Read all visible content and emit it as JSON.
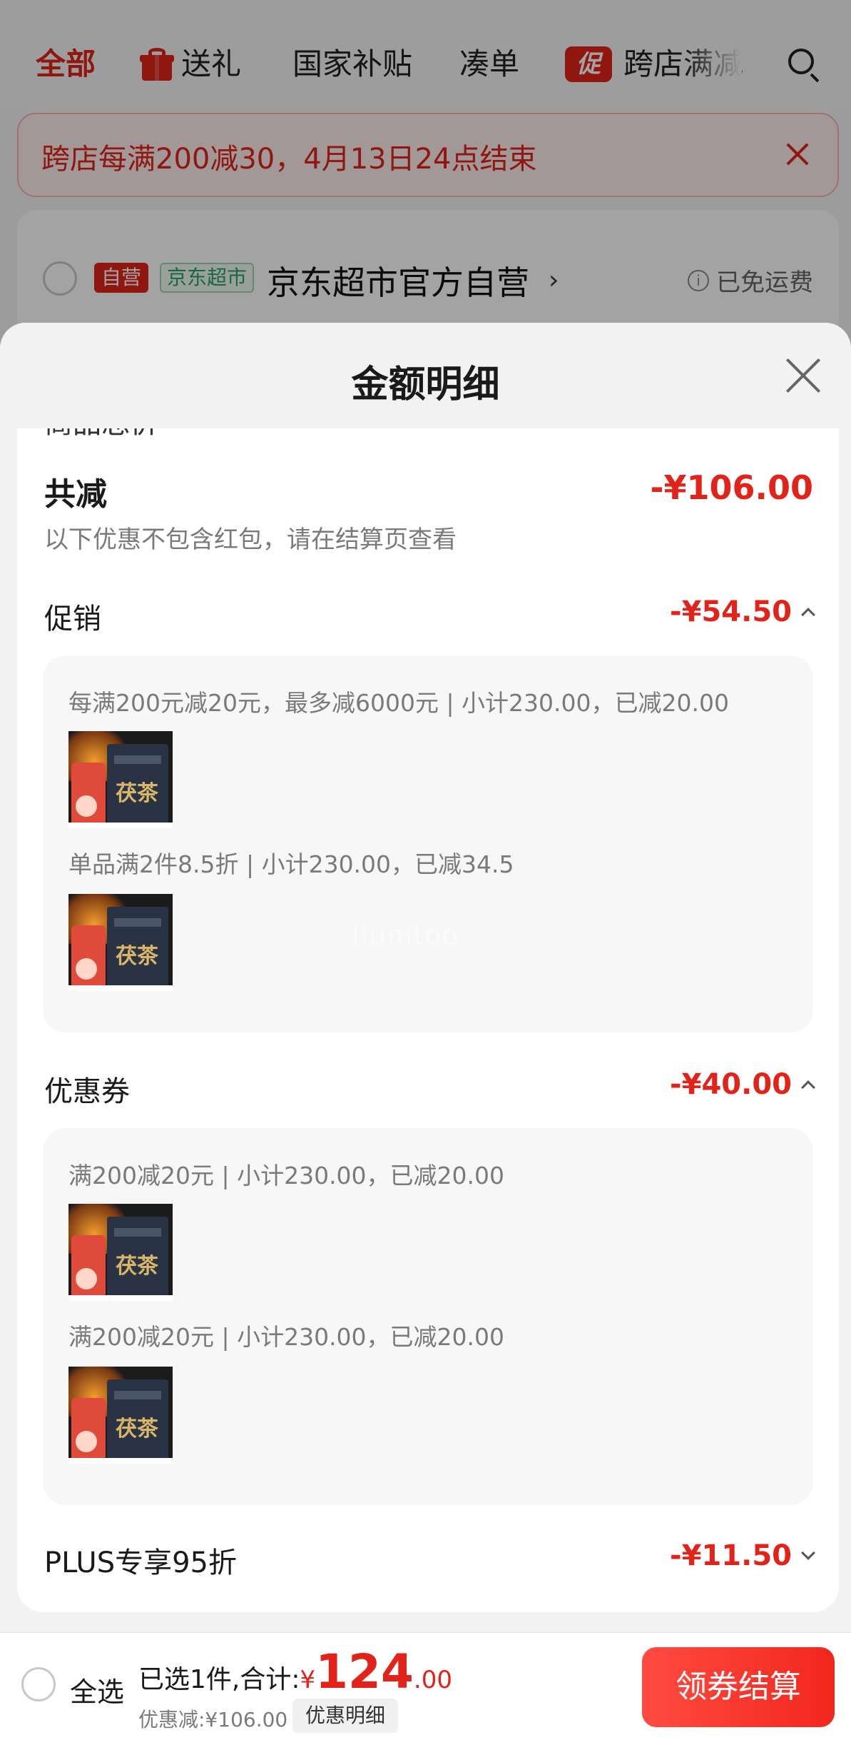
{
  "top_nav": {
    "tabs": [
      {
        "label": "全部"
      },
      {
        "label": "送礼",
        "icon": "gift-icon"
      },
      {
        "label": "国家补贴"
      },
      {
        "label": "凑单"
      },
      {
        "label": "跨店满减",
        "badge": "促"
      }
    ]
  },
  "promo_banner": {
    "text": "跨店每满200减30，4月13日24点结束"
  },
  "store": {
    "tag_self": "自营",
    "tag_market": "京东超市",
    "name": "京东超市官方自营",
    "chevron": "›",
    "shipping_icon": "i",
    "shipping": "已免运费"
  },
  "sheet": {
    "title": "金额明细",
    "cut_text": "商品总价",
    "total": {
      "label": "共减",
      "value": "-¥106.00",
      "note": "以下优惠不包含红包，请在结算页查看"
    },
    "promotion": {
      "label": "促销",
      "value": "-¥54.50",
      "items": [
        {
          "text": "每满200元减20元，最多减6000元 | 小计230.00，已减20.00",
          "product_text": "茯茶"
        },
        {
          "text": "单品满2件8.5折 | 小计230.00，已减34.5",
          "product_text": "茯茶"
        }
      ]
    },
    "coupon": {
      "label": "优惠券",
      "value": "-¥40.00",
      "items": [
        {
          "text": "满200减20元 | 小计230.00，已减20.00",
          "product_text": "茯茶"
        },
        {
          "text": "满200减20元 | 小计230.00，已减20.00",
          "product_text": "茯茶"
        }
      ]
    },
    "plus": {
      "label": "PLUS专享95折",
      "value": "-¥11.50"
    }
  },
  "watermark": "liumtoo",
  "bottom_bar": {
    "select_all": "全选",
    "summary_prefix": "已选1件,合计:",
    "currency": "¥",
    "price_int": "124",
    "price_dec": ".00",
    "discount": "优惠减:¥106.00",
    "detail_button": "优惠明细",
    "checkout_button": "领券结算"
  },
  "colors": {
    "accent": "#e2231a",
    "checkout_gradient_start": "#ff4b42",
    "checkout_gradient_end": "#f2271c"
  }
}
